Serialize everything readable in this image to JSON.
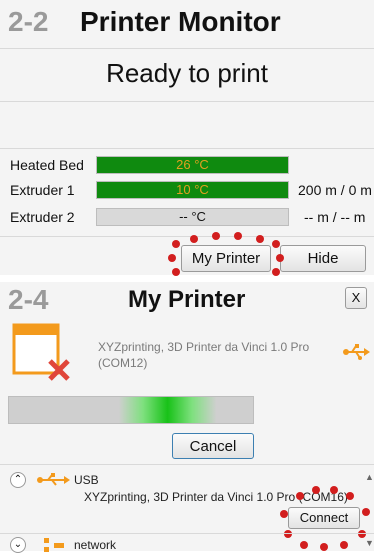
{
  "monitor": {
    "step": "2-2",
    "title": "Printer Monitor",
    "status": "Ready to print",
    "rows": [
      {
        "label": "Heated Bed",
        "value": "26 °C",
        "extra": "",
        "fill": 1.0
      },
      {
        "label": "Extruder 1",
        "value": "10 °C",
        "extra": "200 m / 0 m",
        "fill": 1.0
      },
      {
        "label": "Extruder 2",
        "value": "-- °C",
        "extra": "-- m / -- m",
        "fill": 0.0
      }
    ],
    "my_printer_label": "My Printer",
    "hide_label": "Hide"
  },
  "printer": {
    "step": "2-4",
    "title": "My Printer",
    "close_label": "X",
    "device_line1": "XYZprinting, 3D Printer da Vinci 1.0 Pro",
    "device_line2": "(COM12)",
    "cancel_label": "Cancel",
    "usb_label": "USB",
    "usb_device": "XYZprinting, 3D Printer da Vinci 1.0 Pro (COM16)",
    "connect_label": "Connect",
    "network_label": "network"
  },
  "colors": {
    "accent_green": "#0f8a0f",
    "usb_orange": "#f39a1c",
    "marker_red": "#d21e1e"
  }
}
